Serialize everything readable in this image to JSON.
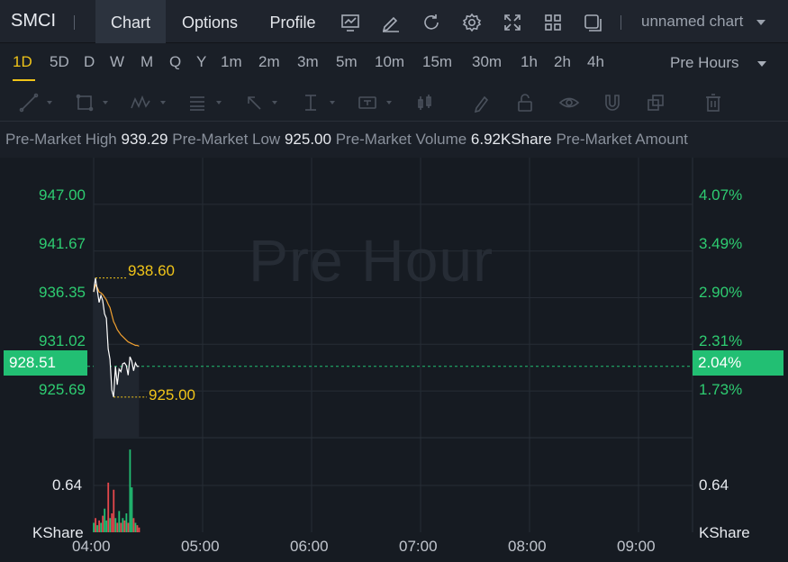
{
  "header": {
    "symbol": "SMCI",
    "tabs": [
      {
        "label": "Chart",
        "active": true
      },
      {
        "label": "Options",
        "active": false
      },
      {
        "label": "Profile",
        "active": false
      }
    ],
    "icons": [
      "indicator-icon",
      "draw-icon",
      "refresh-icon",
      "settings-icon",
      "fullscreen-icon",
      "layout-icon",
      "window-icon"
    ],
    "chart_name": "unnamed chart"
  },
  "intervals": {
    "items": [
      "1D",
      "5D",
      "D",
      "W",
      "M",
      "Q",
      "Y",
      "1m",
      "2m",
      "3m",
      "5m",
      "10m",
      "15m",
      "30m",
      "1h",
      "2h",
      "4h"
    ],
    "active": "1D",
    "session": "Pre Hours"
  },
  "drawing_tools": [
    "trend-line-icon",
    "rectangle-icon",
    "pattern-icon",
    "fib-icon",
    "arrow-icon",
    "measure-icon",
    "text-icon",
    "candle-icon",
    "pen-icon",
    "lock-icon",
    "eye-icon",
    "magnet-icon",
    "copy-icon",
    "trash-icon"
  ],
  "stats": {
    "pm_high_label": "Pre-Market High",
    "pm_high": "939.29",
    "pm_low_label": "Pre-Market Low",
    "pm_low": "925.00",
    "pm_volume_label": "Pre-Market Volume",
    "pm_volume": "6.92KShare",
    "pm_amount_label": "Pre-Market Amount"
  },
  "chart": {
    "watermark": "Pre Hour",
    "price_labels": [
      "947.00",
      "941.67",
      "936.35",
      "931.02",
      "925.69"
    ],
    "pct_labels": [
      "4.07%",
      "3.49%",
      "2.90%",
      "2.31%",
      "1.73%"
    ],
    "current_price": "928.51",
    "current_pct": "2.04%",
    "high_annotation": "938.60",
    "low_annotation": "925.00",
    "volume_label": "0.64",
    "volume_label_right": "0.64",
    "volume_unit": "KShare",
    "volume_unit_right": "KShare",
    "time_labels": [
      "04:00",
      "05:00",
      "06:00",
      "07:00",
      "08:00",
      "09:00"
    ],
    "colors": {
      "up": "#22bf73",
      "down": "#e5484d",
      "price": "#ffffff",
      "avg": "#f0a030",
      "annotation": "#f0c419"
    }
  },
  "chart_data": {
    "type": "line",
    "x": [
      "04:00",
      "04:01",
      "04:02",
      "04:03",
      "04:04",
      "04:05",
      "04:06",
      "04:07",
      "04:08",
      "04:09",
      "04:10",
      "04:11",
      "04:12",
      "04:13",
      "04:14",
      "04:15",
      "04:16",
      "04:17",
      "04:18",
      "04:19",
      "04:20",
      "04:21",
      "04:22",
      "04:23",
      "04:24",
      "04:25"
    ],
    "series": [
      {
        "values": [
          937.0,
          938.6,
          937.2,
          935.8,
          936.6,
          936.0,
          934.5,
          934.0,
          930.5,
          929.3,
          925.8,
          925.0,
          928.5,
          926.4,
          928.2,
          927.9,
          928.8,
          928.9,
          928.6,
          927.5,
          929.6,
          929.1,
          928.0,
          928.9,
          928.5,
          928.51
        ]
      },
      {
        "values": [
          937.0,
          937.8,
          937.5,
          937.0,
          936.9,
          936.7,
          936.4,
          936.1,
          935.6,
          935.2,
          934.4,
          933.6,
          933.2,
          932.7,
          932.4,
          932.1,
          931.9,
          931.7,
          931.5,
          931.3,
          931.2,
          931.1,
          931.0,
          930.9,
          930.9,
          930.8
        ]
      }
    ],
    "volume": [
      0.2,
      0.3,
      0.15,
      0.25,
      0.2,
      0.35,
      0.5,
      0.25,
      1.05,
      0.3,
      0.4,
      0.9,
      0.3,
      0.2,
      0.45,
      0.2,
      0.3,
      0.25,
      0.4,
      0.2,
      1.75,
      0.95,
      0.3,
      0.2,
      0.15,
      0.1
    ],
    "volume_up": [
      true,
      false,
      true,
      false,
      true,
      false,
      true,
      true,
      false,
      true,
      false,
      false,
      true,
      false,
      true,
      false,
      true,
      false,
      true,
      false,
      true,
      true,
      false,
      true,
      false,
      false
    ],
    "ylim": [
      920.36,
      952.33
    ],
    "pct_ylim": [
      1.15,
      4.66
    ],
    "y_ticks": [
      947.0,
      941.67,
      936.35,
      931.02,
      925.69
    ],
    "volume_ylim": [
      0,
      2.0
    ],
    "x_range": [
      "04:00",
      "09:30"
    ]
  }
}
